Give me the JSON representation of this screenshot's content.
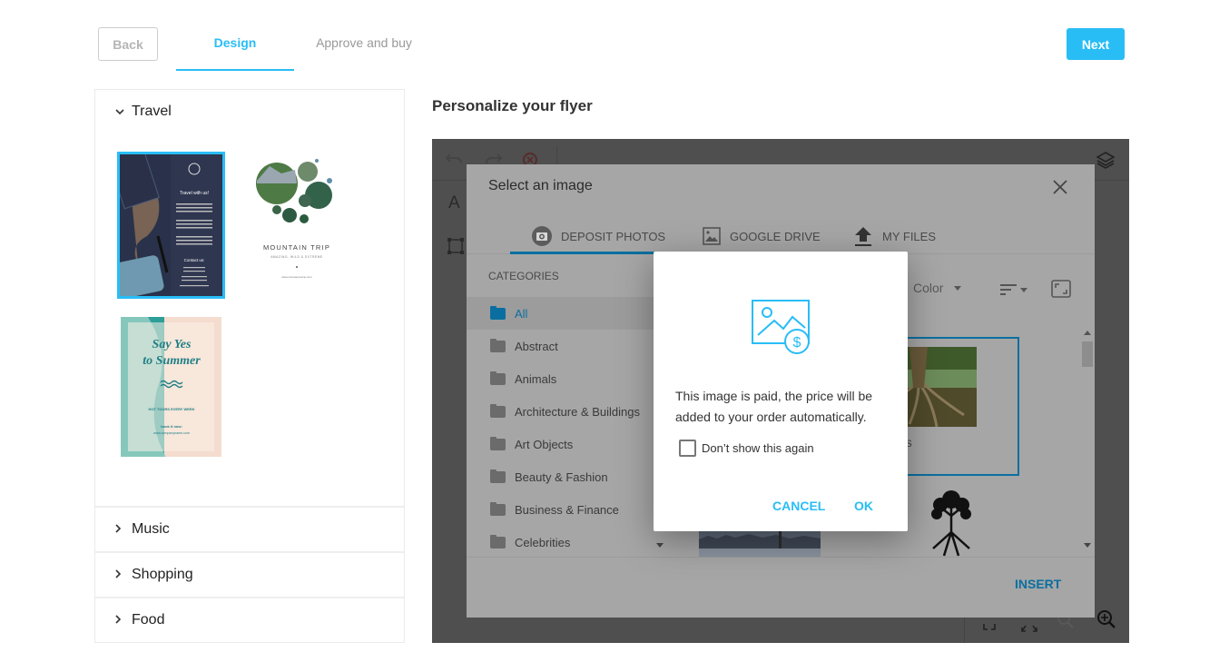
{
  "nav": {
    "back_label": "Back",
    "tabs": [
      {
        "label": "Design",
        "active": true
      },
      {
        "label": "Approve and buy",
        "active": false
      }
    ],
    "next_label": "Next",
    "accent_color": "#29bdf6"
  },
  "templates_panel": {
    "sections": [
      {
        "label": "Travel",
        "expanded": true
      },
      {
        "label": "Music",
        "expanded": false
      },
      {
        "label": "Shopping",
        "expanded": false
      },
      {
        "label": "Food",
        "expanded": false
      }
    ],
    "travel_templates": [
      {
        "name": "Travel with us!",
        "heading": "Travel with us!",
        "contact": "Contact us:",
        "selected": true
      },
      {
        "name": "Mountain Trip",
        "heading": "MOUNTAIN TRIP",
        "subheading": "AMAZING, WILD & EXTREME",
        "url": "www.companyname.com",
        "selected": false
      },
      {
        "name": "Say Yes to Summer",
        "heading_line1": "Say Yes",
        "heading_line2": "to Summer",
        "tagline": "HOT TOURS EVERY WEEK",
        "cta": "book it now:",
        "url": "www.companyname.com",
        "selected": false
      }
    ]
  },
  "editor": {
    "title": "Personalize your flyer",
    "text_tool": "A"
  },
  "image_dialog": {
    "title": "Select an image",
    "tabs": [
      {
        "label": "DEPOSIT PHOTOS",
        "icon": "camera-icon",
        "active": true
      },
      {
        "label": "GOOGLE DRIVE",
        "icon": "image-icon",
        "active": false
      },
      {
        "label": "MY FILES",
        "icon": "upload-icon",
        "active": false
      }
    ],
    "categories_label": "CATEGORIES",
    "categories": [
      {
        "label": "All",
        "active": true
      },
      {
        "label": "Abstract",
        "active": false
      },
      {
        "label": "Animals",
        "active": false
      },
      {
        "label": "Architecture & Buildings",
        "active": false
      },
      {
        "label": "Art Objects",
        "active": false
      },
      {
        "label": "Beauty & Fashion",
        "active": false
      },
      {
        "label": "Business & Finance",
        "active": false
      },
      {
        "label": "Celebrities",
        "active": false
      }
    ],
    "color_filter": "Color",
    "selected_image_caption": "e roots",
    "insert_label": "INSERT"
  },
  "confirm_modal": {
    "message": "This image is paid, the price will be added to your order automatically.",
    "checkbox_label": "Don’t show this again",
    "checkbox_checked": false,
    "cancel_label": "CANCEL",
    "ok_label": "OK"
  }
}
